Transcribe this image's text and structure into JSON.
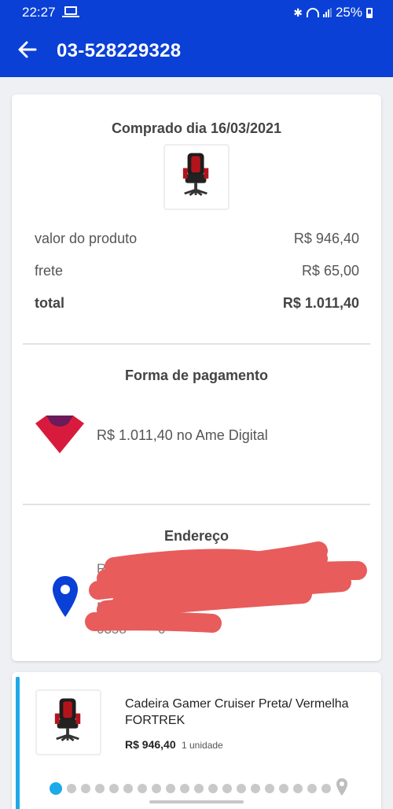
{
  "status_bar": {
    "time": "22:27",
    "battery": "25%"
  },
  "app_bar": {
    "title": "03-528229328"
  },
  "order": {
    "purchase_title": "Comprado dia 16/03/2021",
    "rows": [
      {
        "label": "valor do produto",
        "value": "R$ 946,40"
      },
      {
        "label": "frete",
        "value": "R$ 65,00"
      },
      {
        "label": "total",
        "value": "R$ 1.011,40"
      }
    ]
  },
  "payment": {
    "title": "Forma de pagamento",
    "text": "R$ 1.011,40 no Ame Digital",
    "logo_color": "#d81b3c"
  },
  "address": {
    "title": "Endereço",
    "line1": "Ru",
    "line1_end": "021",
    "line2": "R",
    "line3": "0358",
    "line3_end": "0"
  },
  "item": {
    "name": "Cadeira Gamer Cruiser Preta/ Vermelha FORTREK",
    "price": "R$ 946,40",
    "quantity": "1 unidade",
    "tracking_progress_steps": 20,
    "tracking_current_step": 1
  },
  "colors": {
    "brand": "#0a40d6",
    "accent": "#1ea9e8",
    "pin": "#0a40d6"
  }
}
